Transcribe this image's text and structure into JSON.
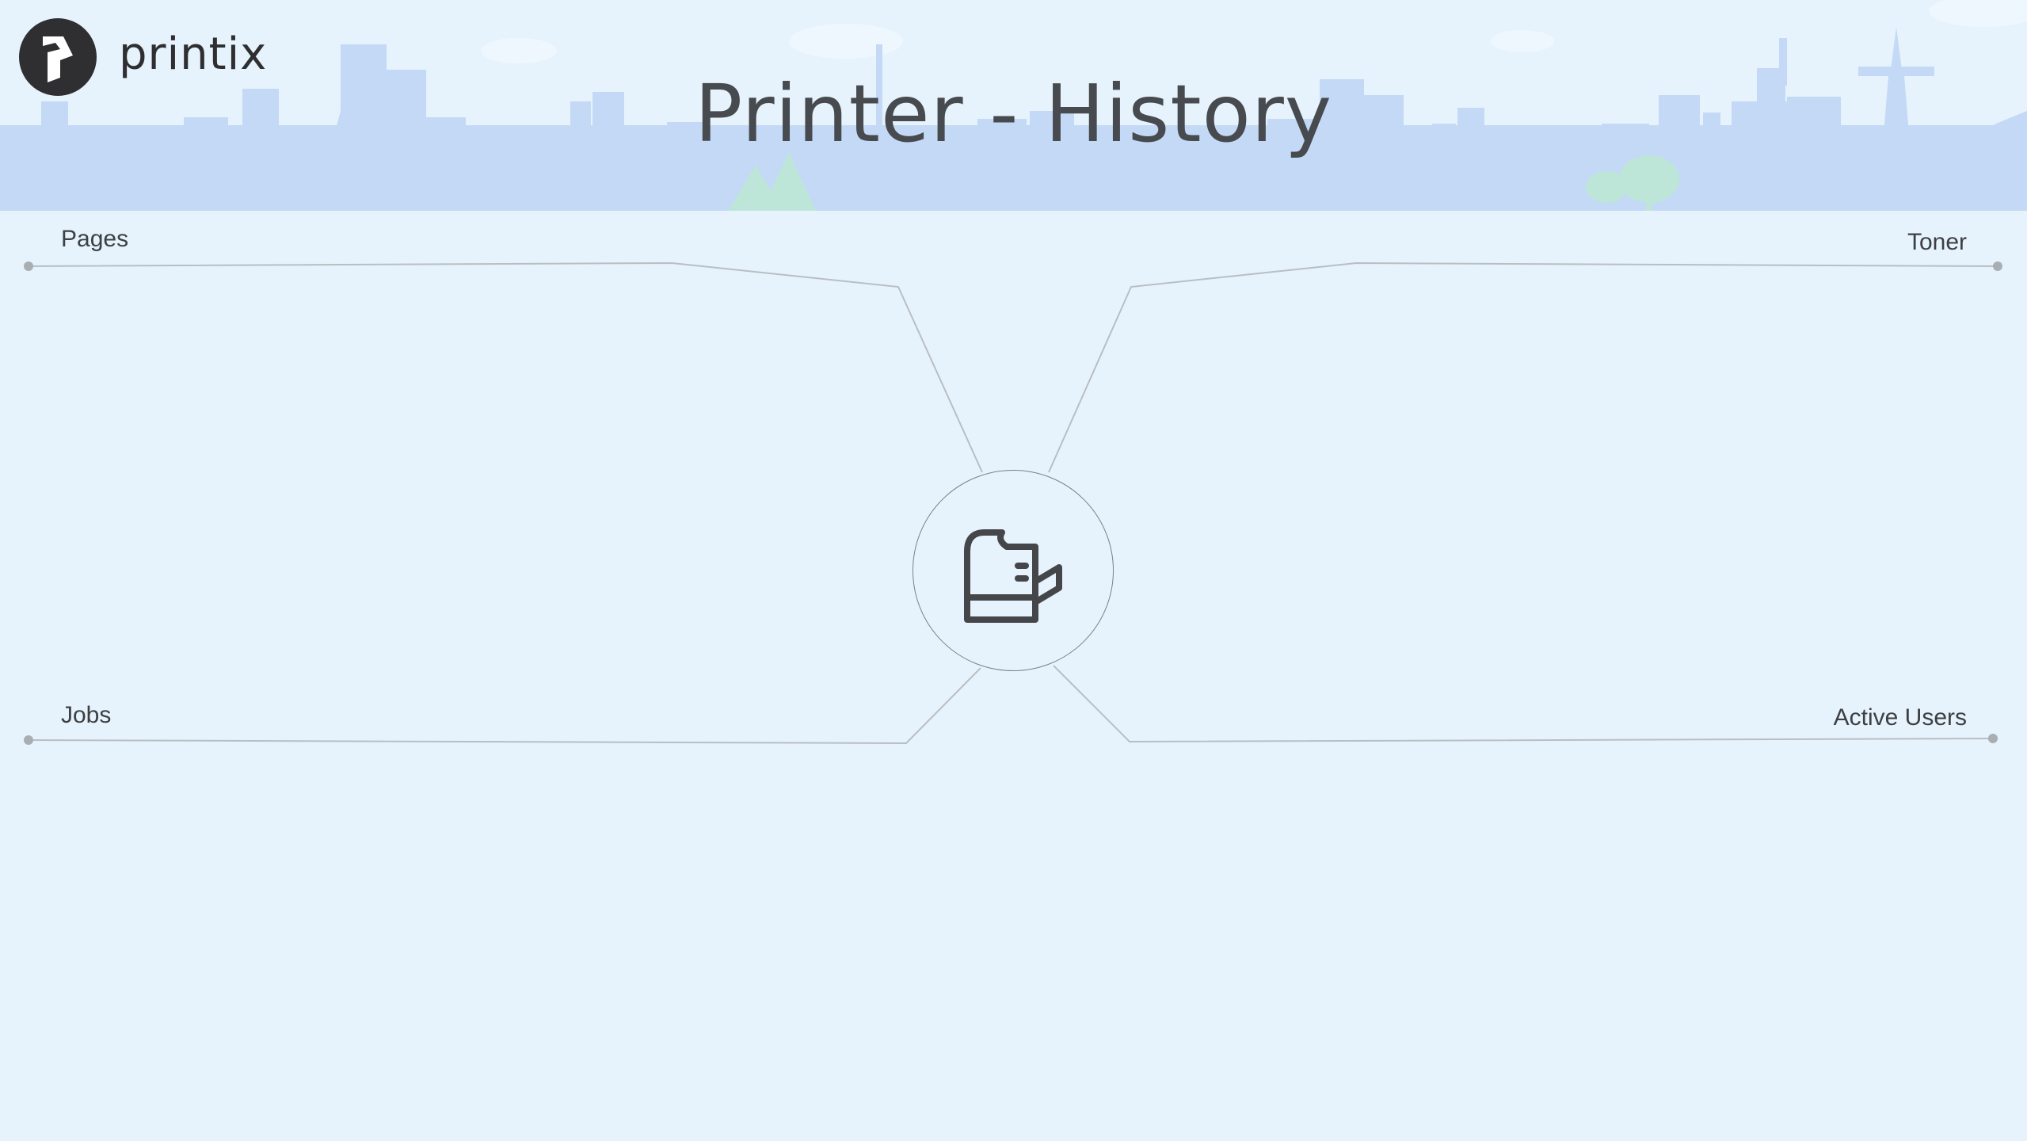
{
  "brand": {
    "name": "printix",
    "logo_icon": "printix-logo-icon"
  },
  "title": "Printer - History",
  "metrics": {
    "pages": {
      "label": "Pages"
    },
    "toner": {
      "label": "Toner"
    },
    "jobs": {
      "label": "Jobs"
    },
    "active_users": {
      "label": "Active Users"
    }
  },
  "hub": {
    "icon": "printer-icon"
  },
  "colors": {
    "background": "#e6f3fc",
    "skyline": "#c4d9f5",
    "text": "#3d3f42",
    "connector": "#b9bec3",
    "dot": "#a9aeb3"
  }
}
